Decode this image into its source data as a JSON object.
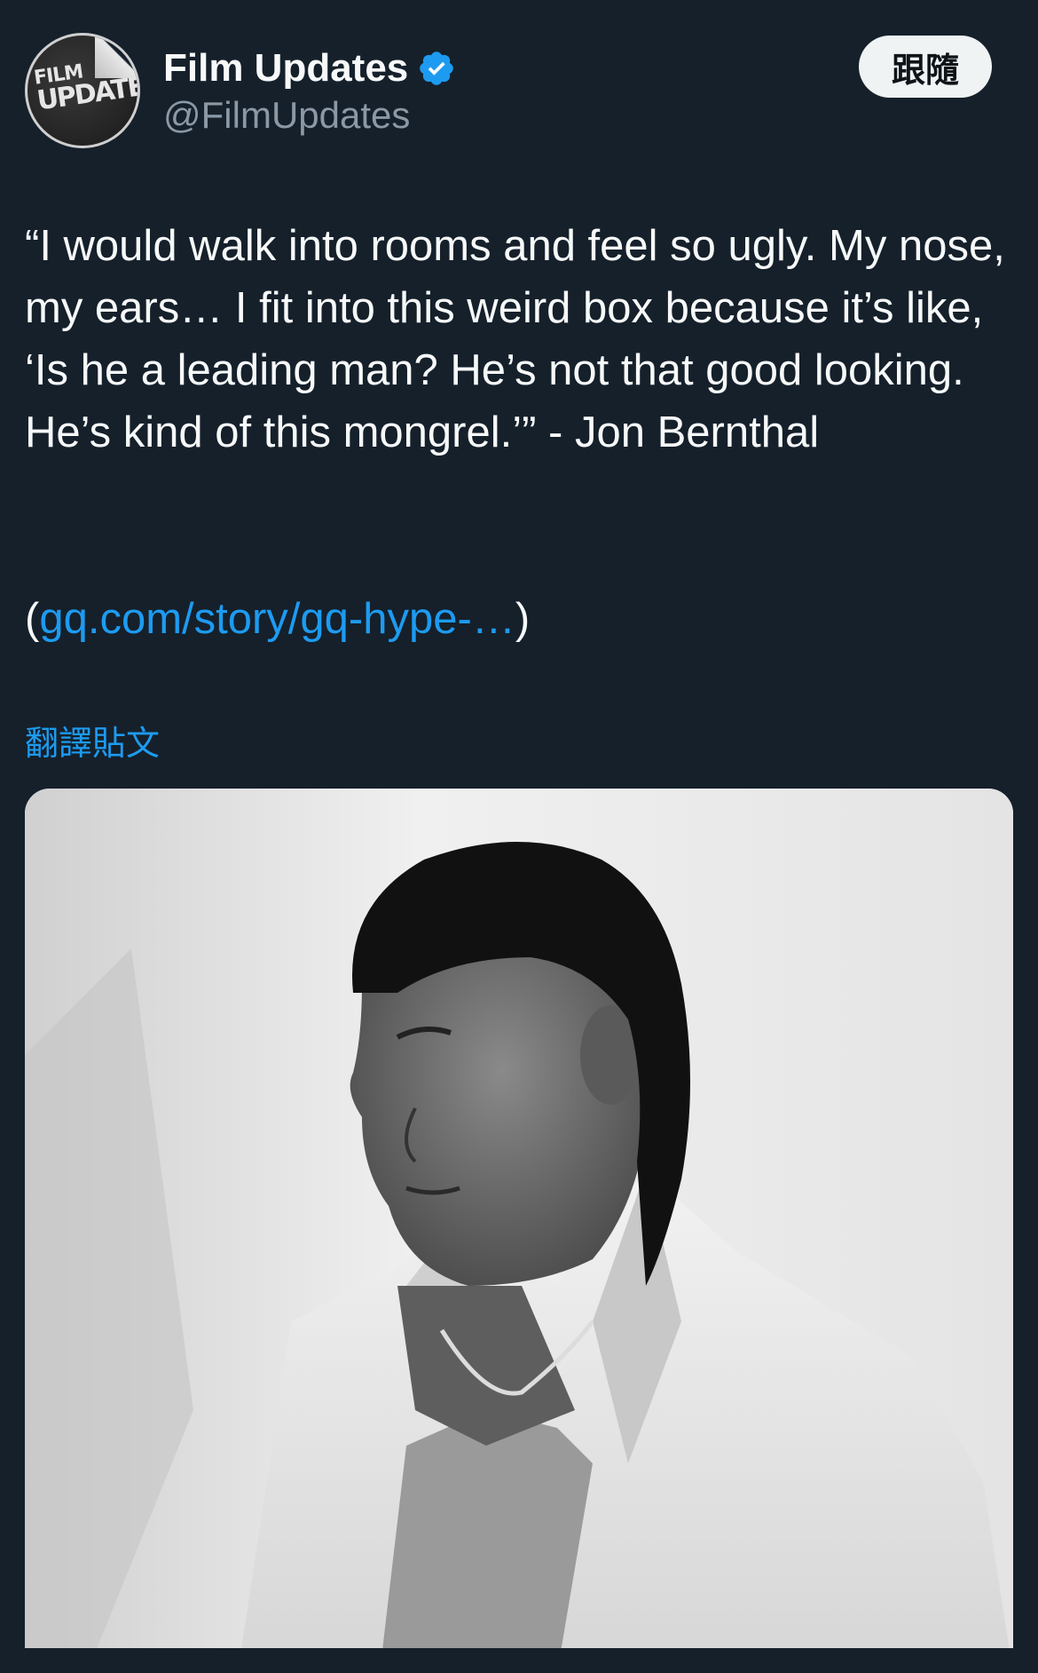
{
  "author": {
    "display_name": "Film Updates",
    "handle": "@FilmUpdates",
    "verified_icon": "verified-badge-icon",
    "avatar": {
      "line1": "FILM",
      "line2": "UPDATES"
    }
  },
  "follow_button": {
    "label": "跟隨"
  },
  "tweet": {
    "text": "“I would walk into rooms and feel so ugly. My nose, my ears… I fit into this weird box because it’s like, ‘Is he a leading man? He’s not that good looking. He’s kind of this mongrel.’” - Jon Bernthal",
    "link_open": "(",
    "link_text": "gq.com/story/gq-hype-…",
    "link_close": ")",
    "translate_label": "翻譯貼文"
  },
  "colors": {
    "background": "#15202b",
    "text": "#f7f9f9",
    "secondary_text": "#8b98a5",
    "accent": "#1d9bf0",
    "follow_button_bg": "#eff3f4"
  }
}
